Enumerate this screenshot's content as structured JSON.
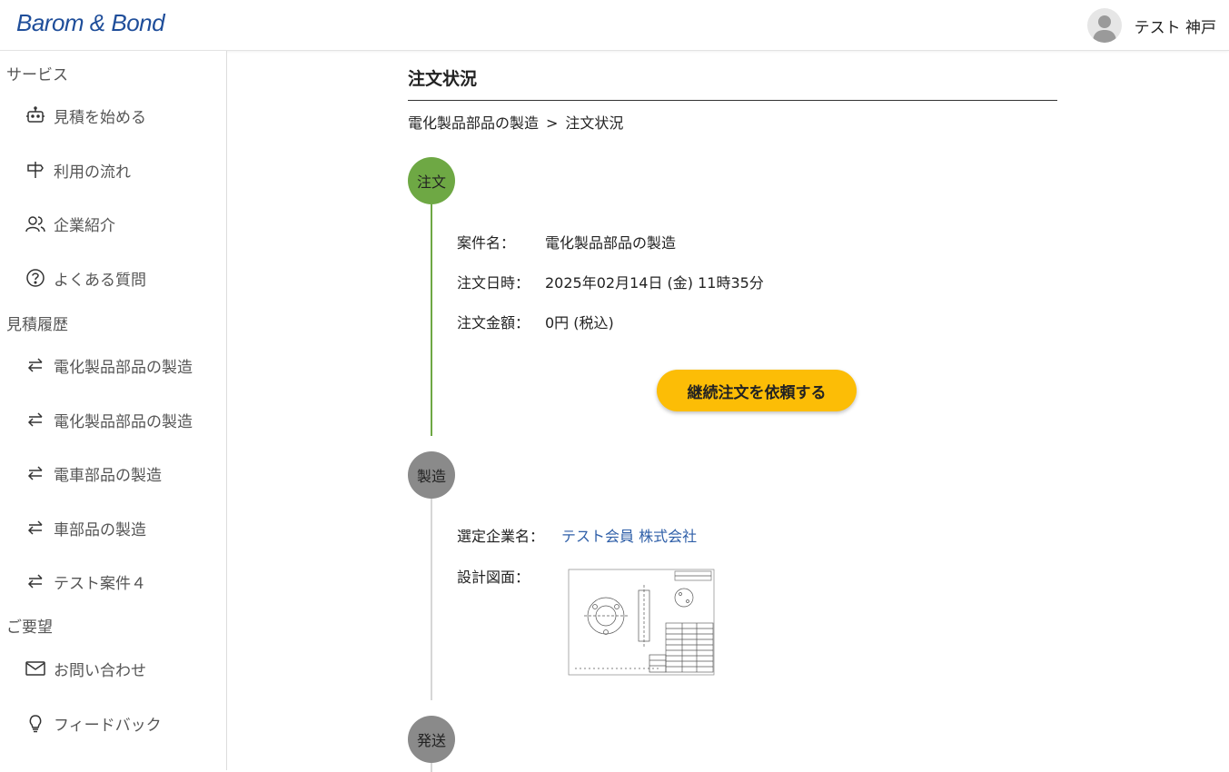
{
  "header": {
    "logo": "Barom & Bond",
    "user_name": "テスト 神戸"
  },
  "sidebar": {
    "sections": [
      {
        "label": "サービス"
      },
      {
        "label": "見積履歴"
      },
      {
        "label": "ご要望"
      }
    ],
    "service_items": [
      {
        "label": "見積を始める",
        "icon": "robot-icon"
      },
      {
        "label": "利用の流れ",
        "icon": "signpost-icon"
      },
      {
        "label": "企業紹介",
        "icon": "users-icon"
      },
      {
        "label": "よくある質問",
        "icon": "question-icon"
      }
    ],
    "history_items": [
      {
        "label": "電化製品部品の製造",
        "icon": "swap-icon"
      },
      {
        "label": "電化製品部品の製造",
        "icon": "swap-icon"
      },
      {
        "label": "電車部品の製造",
        "icon": "swap-icon"
      },
      {
        "label": "車部品の製造",
        "icon": "swap-icon"
      },
      {
        "label": "テスト案件４",
        "icon": "swap-icon"
      }
    ],
    "request_items": [
      {
        "label": "お問い合わせ",
        "icon": "mail-icon"
      },
      {
        "label": "フィードバック",
        "icon": "lightbulb-icon"
      }
    ]
  },
  "main": {
    "title": "注文状況",
    "breadcrumb": {
      "parent": "電化製品部品の製造",
      "separator": ">",
      "current": "注文状況"
    },
    "steps": [
      {
        "label": "注文",
        "color": "#6ea844"
      },
      {
        "label": "製造",
        "color": "#8a8a8a"
      },
      {
        "label": "発送",
        "color": "#8a8a8a"
      }
    ],
    "order": {
      "name_label": "案件名：",
      "name_value": "電化製品部品の製造",
      "date_label": "注文日時：",
      "date_value": "2025年02月14日 (金) 11時35分",
      "amount_label": "注文金額：",
      "amount_value": "0円 (税込)",
      "reorder_button": "継続注文を依頼する"
    },
    "manufacturing": {
      "company_label": "選定企業名：",
      "company_value": "テスト会員 株式会社",
      "drawing_label": "設計図面："
    }
  },
  "colors": {
    "accent": "#fcbd06",
    "active_step": "#6ea844",
    "inactive_step": "#8a8a8a",
    "link": "#2f5fa8",
    "logo": "#1f4e9a"
  }
}
